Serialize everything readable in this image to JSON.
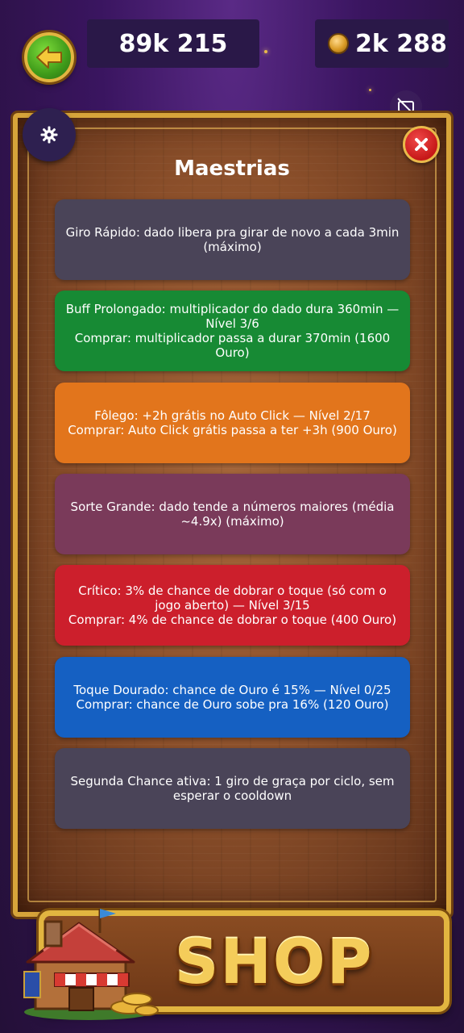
{
  "header": {
    "points": "89k 215",
    "gold": "2k 288"
  },
  "panel": {
    "title": "Maestrias"
  },
  "masteries": [
    {
      "name": "giro-rapido",
      "lines": [
        "Giro Rápido: dado libera pra girar de novo a cada 3min (máximo)"
      ],
      "color": "#4a4458"
    },
    {
      "name": "buff-prolongado",
      "lines": [
        "Buff Prolongado: multiplicador do dado dura 360min — Nível 3/6",
        "Comprar: multiplicador passa a durar 370min (1600 Ouro)"
      ],
      "color": "#178a34"
    },
    {
      "name": "folego",
      "lines": [
        "Fôlego: +2h grátis no Auto Click — Nível 2/17",
        "Comprar: Auto Click grátis passa a ter +3h (900 Ouro)"
      ],
      "color": "#e2751c"
    },
    {
      "name": "sorte-grande",
      "lines": [
        "Sorte Grande: dado tende a números maiores (média ~4.9x) (máximo)"
      ],
      "color": "#7a3a5a"
    },
    {
      "name": "critico",
      "lines": [
        "Crítico: 3% de chance de dobrar o toque (só com o jogo aberto) — Nível 3/15",
        "Comprar: 4% de chance de dobrar o toque (400 Ouro)"
      ],
      "color": "#cc1f2c"
    },
    {
      "name": "toque-dourado",
      "lines": [
        "Toque Dourado: chance de Ouro é 15% — Nível 0/25",
        "Comprar: chance de Ouro sobe pra 16% (120 Ouro)"
      ],
      "color": "#1560c2"
    },
    {
      "name": "segunda-chance",
      "lines": [
        "Segunda Chance ativa: 1 giro de graça por ciclo, sem esperar o cooldown"
      ],
      "color": "#4a4458"
    }
  ],
  "shop": {
    "label": "SHOP"
  },
  "icons": {
    "back": "arrow-left-icon",
    "coin": "coin-icon",
    "no_ads": "no-ads-icon",
    "settings": "gear-icon",
    "close": "close-icon",
    "shop_house": "shop-house-icon"
  }
}
